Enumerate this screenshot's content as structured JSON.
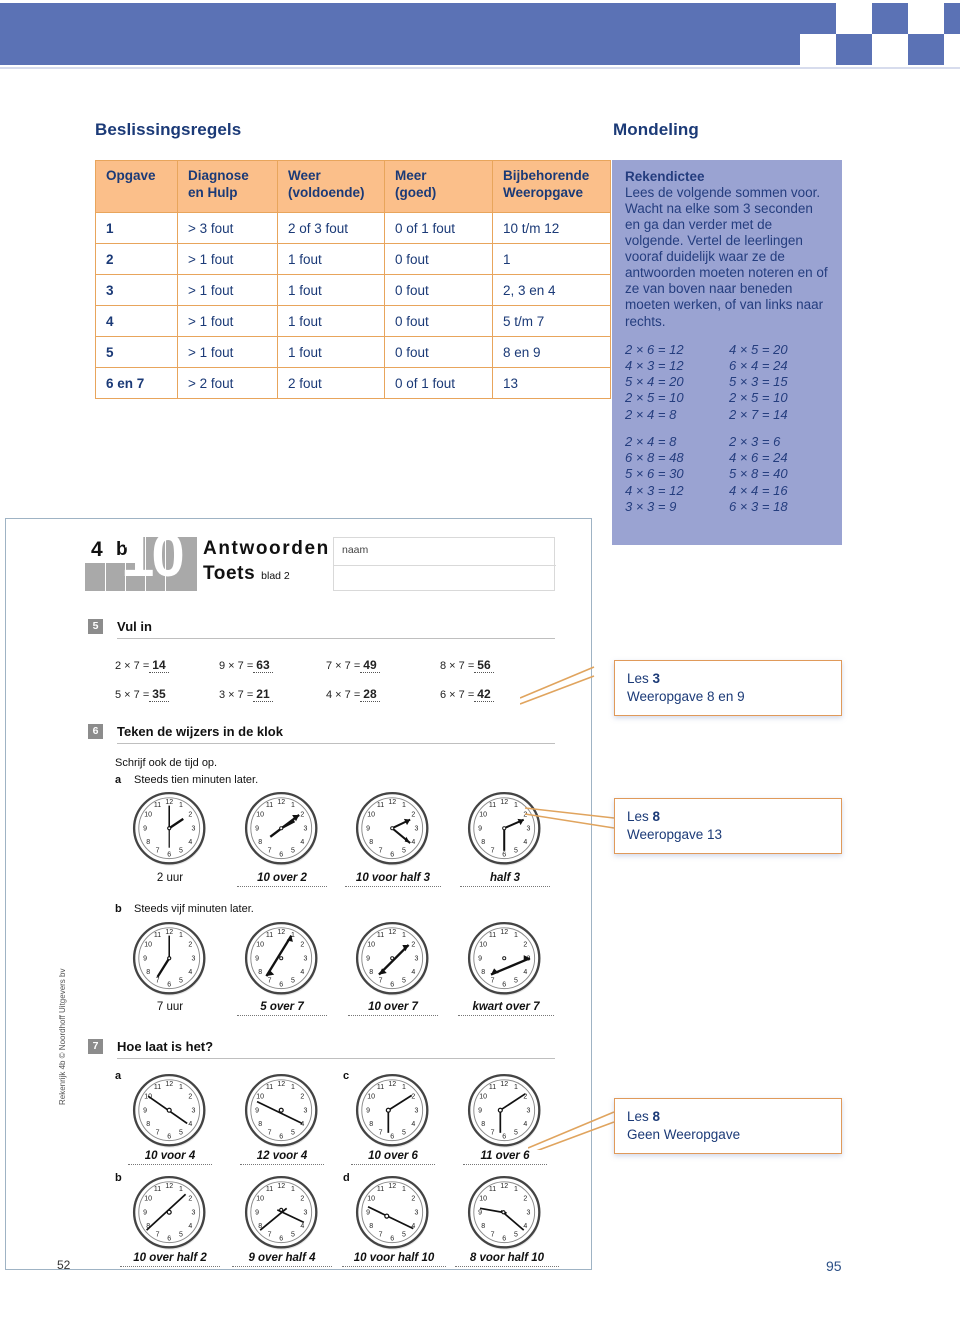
{
  "banner": {
    "color": "#5b72b5"
  },
  "sections": {
    "left_title": "Beslissingsregels",
    "right_title": "Mondeling"
  },
  "decision_table": {
    "headers": [
      "Opgave",
      "Diagnose en Hulp",
      "Weer (voldoende)",
      "Meer (goed)"
    ],
    "headers_split": [
      [
        "Opgave",
        ""
      ],
      [
        "Diagnose",
        "en Hulp"
      ],
      [
        "Weer",
        "(voldoende)"
      ],
      [
        "Meer",
        "(goed)"
      ]
    ],
    "rows": [
      [
        "1",
        "> 3 fout",
        "2 of 3 fout",
        "0 of 1 fout"
      ],
      [
        "2",
        "> 1 fout",
        "1 fout",
        "0 fout"
      ],
      [
        "3",
        "> 1 fout",
        "1 fout",
        "0 fout"
      ],
      [
        "4",
        "> 1 fout",
        "1 fout",
        "0 fout"
      ],
      [
        "5",
        "> 1 fout",
        "1 fout",
        "0 fout"
      ],
      [
        "6 en 7",
        "> 2 fout",
        "2 fout",
        "0 of 1 fout"
      ]
    ]
  },
  "weeropgave_table": {
    "header_lines": [
      "Bijbehorende",
      "Weeropgave"
    ],
    "rows": [
      "10 t/m 12",
      "1",
      "2, 3 en 4",
      "5 t/m 7",
      "8 en 9",
      "13"
    ]
  },
  "rekendictee": {
    "title": "Rekendictee",
    "body": "Lees de volgende sommen voor. Wacht na elke som 3 seconden en ga dan verder met de volgende. Vertel de leerlingen vooraf duidelijk waar ze de antwoorden moeten noteren en of ze van boven naar beneden moeten werken, of van links naar rechts.",
    "group1": [
      [
        "2 × 6 = 12",
        "4 × 5 = 20"
      ],
      [
        "4 × 3 = 12",
        "6 × 4 = 24"
      ],
      [
        "5 × 4 = 20",
        "5 × 3 = 15"
      ],
      [
        "2 × 5 = 10",
        "2 × 5 = 10"
      ],
      [
        "2 × 4 =  8",
        "2 × 7 = 14"
      ]
    ],
    "group2": [
      [
        "2 × 4 =  8",
        "2 × 3 =  6"
      ],
      [
        "6 × 8 = 48",
        "4 × 6 = 24"
      ],
      [
        "5 × 6 = 30",
        "5 × 8 = 40"
      ],
      [
        "4 × 3 = 12",
        "4 × 4 = 16"
      ],
      [
        "3 × 3 =  9",
        "6 × 3 = 18"
      ]
    ]
  },
  "worksheet": {
    "masthead": {
      "grade": "4",
      "level": "b",
      "block": "10",
      "title_line1": "Antwoorden",
      "title_line2": "Toets",
      "sheet_label": "blad 2",
      "name_label": "naam"
    },
    "ex5": {
      "number": "5",
      "heading": "Vul in",
      "items": [
        {
          "expr": "2 × 7 = ",
          "answer": "14"
        },
        {
          "expr": "9 × 7 = ",
          "answer": "63"
        },
        {
          "expr": "7 × 7 = ",
          "answer": "49"
        },
        {
          "expr": "8 × 7 = ",
          "answer": "56"
        },
        {
          "expr": "5 × 7 = ",
          "answer": "35"
        },
        {
          "expr": "3 × 7 = ",
          "answer": "21"
        },
        {
          "expr": "4 × 7 = ",
          "answer": "28"
        },
        {
          "expr": "6 × 7 = ",
          "answer": "42"
        }
      ]
    },
    "ex6": {
      "number": "6",
      "heading": "Teken de wijzers in de klok",
      "instruction": "Schrijf ook de tijd op.",
      "row_a": {
        "letter": "a",
        "label": "Steeds tien minuten later.",
        "clocks": [
          {
            "time": "2 uur",
            "filled": false,
            "hour": 2,
            "minute": 0
          },
          {
            "time": "10 over 2",
            "filled": true,
            "hour": 2,
            "minute": 10
          },
          {
            "time": "10 voor half 3",
            "filled": true,
            "hour": 2,
            "minute": 20
          },
          {
            "time": "half 3",
            "filled": true,
            "hour": 2,
            "minute": 30
          }
        ]
      },
      "row_b": {
        "letter": "b",
        "label": "Steeds vijf minuten later.",
        "clocks": [
          {
            "time": "7 uur",
            "filled": false,
            "hour": 7,
            "minute": 0
          },
          {
            "time": "5 over 7",
            "filled": true,
            "hour": 7,
            "minute": 5
          },
          {
            "time": "10 over 7",
            "filled": true,
            "hour": 7,
            "minute": 10
          },
          {
            "time": "kwart over 7",
            "filled": true,
            "hour": 7,
            "minute": 15
          }
        ]
      }
    },
    "ex7": {
      "number": "7",
      "heading": "Hoe laat is het?",
      "rows": [
        {
          "letter": "a",
          "clocks": [
            {
              "time": "10 voor 4",
              "hour": 3,
              "minute": 50
            },
            {
              "time": "12 voor 4",
              "hour": 3,
              "minute": 48
            }
          ]
        },
        {
          "letter": "c",
          "clocks": [
            {
              "time": "10 over 6",
              "hour": 6,
              "minute": 10
            },
            {
              "time": "11 over 6",
              "hour": 6,
              "minute": 11
            }
          ]
        },
        {
          "letter": "b",
          "clocks": [
            {
              "time": "10 over half 2",
              "hour": 1,
              "minute": 40
            },
            {
              "time": "9 over half 4",
              "hour": 3,
              "minute": 39
            }
          ]
        },
        {
          "letter": "d",
          "clocks": [
            {
              "time": "10 voor half 10",
              "hour": 9,
              "minute": 20
            },
            {
              "time": "8 voor half 10",
              "hour": 9,
              "minute": 22
            }
          ]
        }
      ]
    }
  },
  "callouts": [
    {
      "line1_pre": "Les ",
      "line1_num": "3",
      "line2": "Weeropgave 8 en 9"
    },
    {
      "line1_pre": "Les ",
      "line1_num": "8",
      "line2": "Weeropgave 13"
    },
    {
      "line1_pre": "Les ",
      "line1_num": "8",
      "line2": "Geen Weeropgave"
    }
  ],
  "footer": {
    "credit": "Rekenrijk 4b © Noordhoff Uitgevers bv",
    "worksheet_page": "52",
    "book_page": "95"
  }
}
